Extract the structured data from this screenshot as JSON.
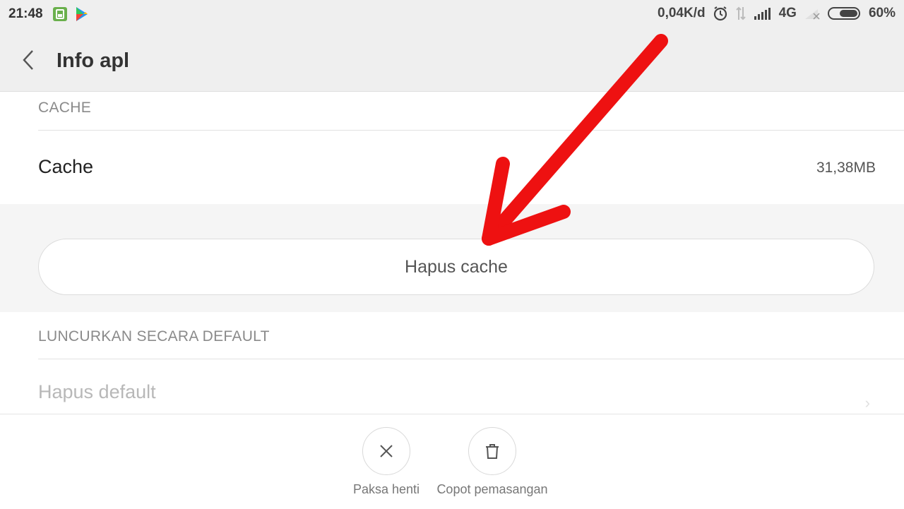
{
  "status_bar": {
    "time": "21:48",
    "network_speed": "0,04K/d",
    "network_type": "4G",
    "battery": "60%",
    "icons": [
      "sim-icon",
      "play-store-icon",
      "alarm-icon",
      "data-arrows-icon",
      "signal-icon",
      "wifi-off-icon",
      "battery-icon"
    ]
  },
  "app_bar": {
    "title": "Info apl"
  },
  "cache_section": {
    "header": "CACHE",
    "row_label": "Cache",
    "row_value": "31,38MB",
    "button_label": "Hapus cache"
  },
  "default_section": {
    "header": "LUNCURKAN SECARA DEFAULT",
    "row_label": "Hapus default"
  },
  "bottom_actions": [
    {
      "label": "Paksa henti",
      "icon": "close-icon"
    },
    {
      "label": "Copot pemasangan",
      "icon": "trash-icon"
    }
  ],
  "annotation": {
    "color": "#ee1111"
  }
}
